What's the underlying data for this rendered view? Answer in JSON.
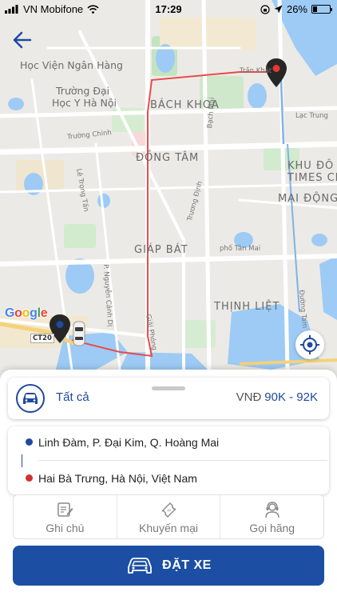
{
  "status_bar": {
    "carrier": "VN Mobifone",
    "time": "17:29",
    "battery": "26%",
    "battery_level": 0.26
  },
  "map": {
    "areas": [
      "BÁCH KHOA",
      "ĐỒNG TÂM",
      "GIÁP BÁT",
      "THỊNH LIỆT",
      "MAI ĐỘNG",
      "KHU ĐÔ",
      "TIMES CI"
    ],
    "pois": [
      "Học Viện Ngân Hàng",
      "Trường Đại",
      "Học Y Hà Nội"
    ],
    "streets": [
      "Trường Chinh",
      "Lê Trọng Tấn",
      "Bạch Mai",
      "Trương Định",
      "Lạc Trung",
      "Trần Khát",
      "phố Tân Mai",
      "P. Nguyễn Cảnh Dị",
      "Giải Phóng",
      "Đường Tam T",
      "CT20"
    ],
    "google_logo": "Google",
    "colors": {
      "route": "#e94b4b",
      "pin": "#222222",
      "water": "#9dcbf5",
      "park": "#c3e4c0"
    }
  },
  "vehicle": {
    "type_label": "Tất cả",
    "currency": "VNĐ",
    "price_range": "90K - 92K",
    "icon": "car-icon"
  },
  "route": {
    "pickup": "Linh Đàm, P. Đại Kim, Q. Hoàng Mai",
    "dropoff": "Hai Bà Trưng, Hà Nội, Việt Nam",
    "pickup_color": "#1e4aa0",
    "dropoff_color": "#d32f2f"
  },
  "actions": [
    {
      "label": "Ghi chú",
      "icon": "note-icon"
    },
    {
      "label": "Khuyến mại",
      "icon": "promo-ticket-icon"
    },
    {
      "label": "Gọi hãng",
      "icon": "call-operator-icon"
    }
  ],
  "book_button": {
    "label": "ĐẶT XE",
    "color": "#1c4fa3"
  }
}
